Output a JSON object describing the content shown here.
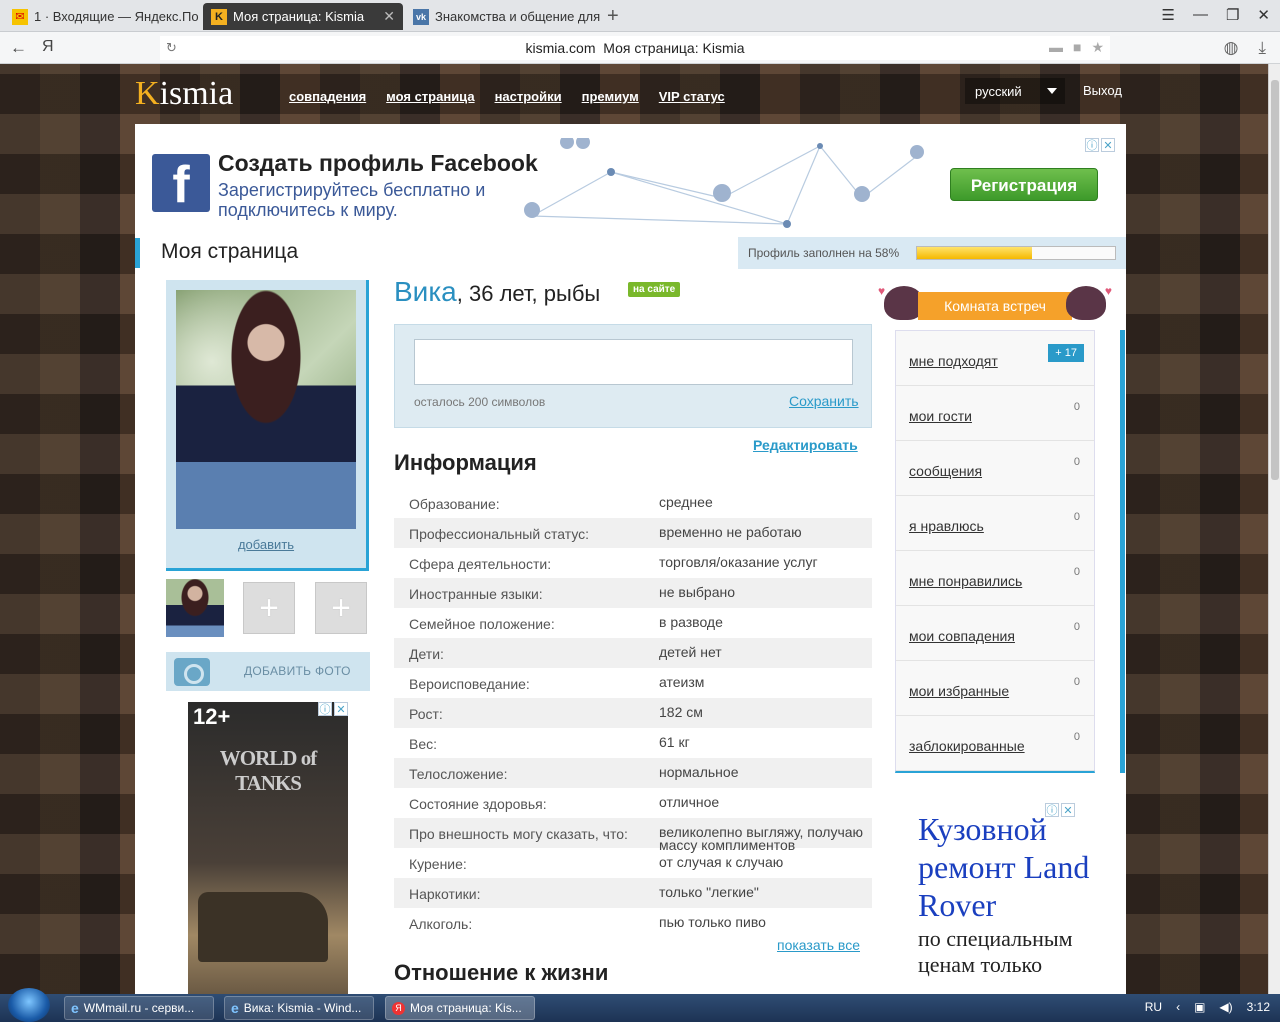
{
  "browser": {
    "tabs": [
      {
        "title": "1 · Входящие — Яндекс.По",
        "icon": "yandex-mail-icon"
      },
      {
        "title": "Моя страница: Kismia",
        "icon": "kismia-icon",
        "close": "✕"
      },
      {
        "title": "Знакомства и общение для",
        "icon": "vk-icon"
      }
    ],
    "new_tab": "+",
    "yandex_y": "Я",
    "address": "kismia.com",
    "page_title": "Моя страница: Kismia"
  },
  "site": {
    "logo_k": "K",
    "logo_rest": "ismia",
    "nav": [
      "совпадения",
      "моя страница",
      "настройки",
      "премиум",
      "VIP статус"
    ],
    "language": "русский",
    "logout": "Выход"
  },
  "fb_ad": {
    "logo": "f",
    "title": "Создать профиль Facebook",
    "subtitle": "Зарегистрируйтесь бесплатно и подключитесь к миру.",
    "button": "Регистрация"
  },
  "page": {
    "title": "Моя страница",
    "progress_text": "Профиль заполнен на 58%",
    "progress_value": 0.58
  },
  "photo": {
    "add": "добавить",
    "plus": "+",
    "add_photo": "ДОБАВИТЬ ФОТО"
  },
  "wot_ad": {
    "age": "12+",
    "logo": "WORLD of TANKS"
  },
  "profile": {
    "first_name": "Вика",
    "details": ", 36 лет, рыбы",
    "online": "на сайте",
    "status_left": "осталось 200 символов",
    "status_save": "Сохранить",
    "edit": "Редактировать",
    "info_heading": "Информация",
    "info": [
      {
        "k": "Образование:",
        "v": "среднее"
      },
      {
        "k": "Профессиональный статус:",
        "v": "временно не работаю"
      },
      {
        "k": "Сфера деятельности:",
        "v": "торговля/оказание услуг"
      },
      {
        "k": "Иностранные языки:",
        "v": "не выбрано"
      },
      {
        "k": "Семейное положение:",
        "v": "в разводе"
      },
      {
        "k": "Дети:",
        "v": "детей нет"
      },
      {
        "k": "Вероисповедание:",
        "v": "атеизм"
      },
      {
        "k": "Рост:",
        "v": "182 см"
      },
      {
        "k": "Вес:",
        "v": "61 кг"
      },
      {
        "k": "Телосложение:",
        "v": "нормальное"
      },
      {
        "k": "Состояние здоровья:",
        "v": "отличное"
      },
      {
        "k": "Про внешность могу сказать, что:",
        "v": "великолепно выгляжу, получаю массу комплиментов"
      },
      {
        "k": "Курение:",
        "v": "от случая к случаю"
      },
      {
        "k": "Наркотики:",
        "v": "только \"легкие\""
      },
      {
        "k": "Алкоголь:",
        "v": "пью только пиво"
      }
    ],
    "show_all": "показать все",
    "life_heading": "Отношение к жизни"
  },
  "sidebar": {
    "meet_room": "Комната встреч",
    "items": [
      {
        "label": "мне подходят",
        "count": "+ 17",
        "badge": true
      },
      {
        "label": "мои гости",
        "count": "0"
      },
      {
        "label": "сообщения",
        "count": "0"
      },
      {
        "label": "я нравлюсь",
        "count": "0"
      },
      {
        "label": "мне понравились",
        "count": "0"
      },
      {
        "label": "мои совпадения",
        "count": "0"
      },
      {
        "label": "мои избранные",
        "count": "0"
      },
      {
        "label": "заблокированные",
        "count": "0"
      }
    ]
  },
  "rover_ad": {
    "headline": "Кузовной ремонт Land Rover",
    "text": "по специальным ценам только"
  },
  "taskbar": {
    "items": [
      "WMmail.ru - серви...",
      "Вика: Kismia - Wind...",
      "Моя страница: Kis..."
    ],
    "lang": "RU",
    "time": "3:12"
  },
  "colors": {
    "accent": "#29a3d6",
    "brand_orange": "#f5a12a",
    "fb_blue": "#3b5998"
  }
}
